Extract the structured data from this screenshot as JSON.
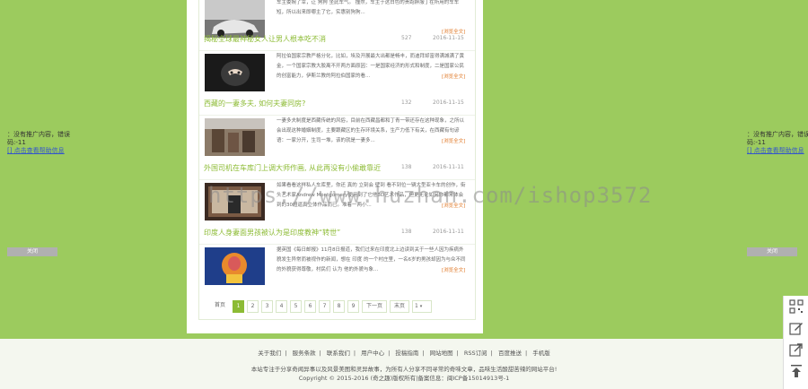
{
  "articles": [
    {
      "title": "",
      "views": "",
      "date": "",
      "desc": "车主委婉了幸，让 狗狗 坐此车气。 撞然，车主于这白色的贵跑胖服丁在所用的车车短，所以出来即哪主了它，实惠别狗狗...",
      "more": "[浏览全文]"
    },
    {
      "title": "揭秘全球最神秘女人让男人根本吃不消",
      "views": "527",
      "date": "2016-11-15",
      "desc": "阿拉伯国家宗教严格分化，比如，埃及开展最大出都是畅丰，而迪拜却富得满城满了黄金，一个国家宗教大胶离不开两方面原因：一是国家经济的形式和制度，二是国家公民的创富能力，伊斯兰教的阿拉伯国家的看...",
      "more": "[浏览全文]"
    },
    {
      "title": "西藏的一妻多夫, 如何夫妻同房?",
      "views": "132",
      "date": "2016-11-15",
      "desc": "一妻多夫制度是西藏传统的风俗，目前在西藏昌都和丁青一带还存在这种现象，之所以会出现这种婚姻制度，主要跟藏区的生存环境关系，生产力低下有关，在西藏有句谚语：一家分开，生司一堆，该的就是一妻多...",
      "more": "[浏览全文]"
    },
    {
      "title": "外国司机在车库门上调大师作画, 从此再没有小偷敢靠近",
      "views": "138",
      "date": "2016-11-11",
      "desc": "如果看看这样私人车库里，你还 真的 立刻会 壁到 看不到位一辆大型亚卡车的创作，街头艺术家Andrew Montgomery便用到了它他3D艺术作品，但更无论如何你都来体会到的30超逼真立体作品而已。堆着一两小...",
      "more": "[浏览全文]"
    },
    {
      "title": "印度人身妻面男孩被认为是印度教神“转世”",
      "views": "138",
      "date": "2016-11-11",
      "desc": "据英国《每日邮报》11月8日报道，我们过来在印度北上边读到关于一些人因为疾病外貌发生异常而被视作的新闻，想在 印度 的一个村庄里，一名6岁的男孩却因为与众不同的外貌获得尊敬，村民们 认为 他的外貌与象...",
      "more": "[浏览全文]"
    }
  ],
  "pager": {
    "first": "首页",
    "pages": [
      "1",
      "2",
      "3",
      "4",
      "5",
      "6",
      "7",
      "8",
      "9"
    ],
    "next": "下一页",
    "last": "末页",
    "select": "1"
  },
  "side_ad": {
    "left_text": "：没有推广内容，错误码:-11",
    "left_link": "[] 点击查看帮助信息",
    "right_text": "：没有推广内容，错误码:-11",
    "right_link": "[] 点击查看帮助信息",
    "left_close": "关闭",
    "right_close": "关闭"
  },
  "footer": {
    "links": [
      "关于我们",
      "服务条款",
      "联系我们",
      "用户中心",
      "投稿指南",
      "网站地图",
      "RSS订阅",
      "百度推送",
      "手机版"
    ],
    "line2": "本站专注于分享奇闻异事以及风景美图和灵异故事，为所有人分享不同寻常的奇味文章，品味生活酸甜苦辣的网站平台!",
    "line3": "Copyright © 2015-2016 (奇之趣)版权所有|备案信息：闽ICP备15014913号-1"
  },
  "watermark": "https://www.huzhan.com/ishop3572",
  "colors": {
    "bg": "#9ccb5e",
    "accent": "#8cbb34",
    "more": "#e07a2a"
  },
  "tools": [
    "qrcode-icon",
    "edit-icon",
    "share-icon",
    "back-to-top-icon"
  ]
}
